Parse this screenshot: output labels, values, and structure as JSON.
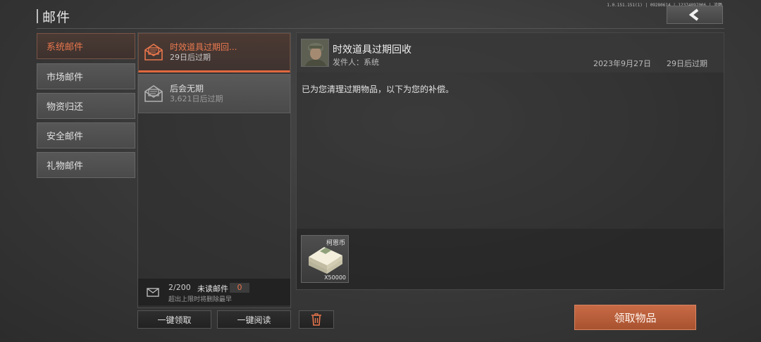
{
  "header": {
    "title": "邮件",
    "version": "1.0.151.151(1) | 09280614 | 12374897006 | 流畅"
  },
  "categories": [
    {
      "label": "系统邮件",
      "active": true
    },
    {
      "label": "市场邮件",
      "active": false
    },
    {
      "label": "物资归还",
      "active": false
    },
    {
      "label": "安全邮件",
      "active": false
    },
    {
      "label": "礼物邮件",
      "active": false
    }
  ],
  "mail_list": [
    {
      "title": "时效道具过期回...",
      "subtitle": "29日后过期",
      "active": true
    },
    {
      "title": "后会无期",
      "subtitle": "3,621日后过期",
      "active": false
    }
  ],
  "mailbox": {
    "count": "2/200",
    "unread_label": "未读邮件",
    "unread_count": "0",
    "note": "超出上限时将删除最早"
  },
  "actions": {
    "claim_all": "一键领取",
    "read_all": "一键阅读",
    "claim_items": "领取物品"
  },
  "mail": {
    "title": "时效道具过期回收",
    "sender": "发件人：系统",
    "date": "2023年9月27日",
    "expire": "29日后过期",
    "body": "已为您清理过期物品，以下为您的补偿。"
  },
  "attachment": {
    "name": "柯恩币",
    "quantity": "X50000"
  },
  "colors": {
    "accent": "#e8764c",
    "claim_button": "#b85c38"
  },
  "icons": {
    "back": "chevron-left-icon",
    "mail": "envelope-icon",
    "delete": "trash-icon"
  }
}
